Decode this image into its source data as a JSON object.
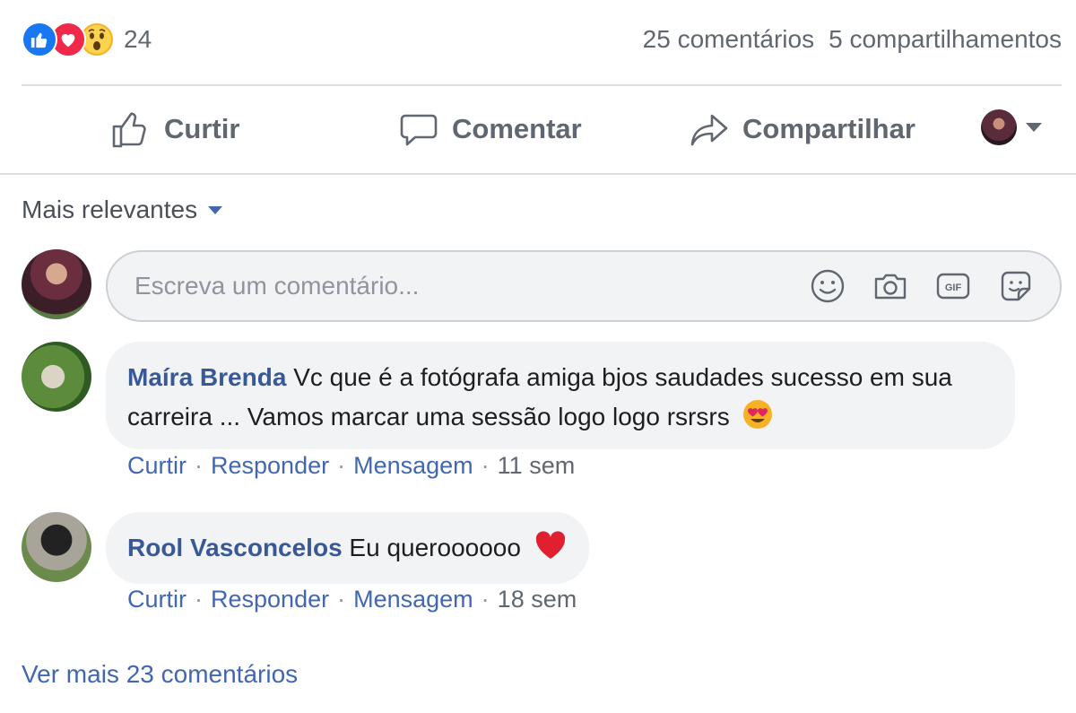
{
  "stats": {
    "reaction_icons": [
      "like-icon",
      "love-icon",
      "wow-icon"
    ],
    "reaction_count": "24",
    "comments_count": "25 comentários",
    "shares_count": "5 compartilhamentos"
  },
  "actions": {
    "like_label": "Curtir",
    "comment_label": "Comentar",
    "share_label": "Compartilhar"
  },
  "sort": {
    "label": "Mais relevantes"
  },
  "composer": {
    "placeholder": "Escreva um comentário..."
  },
  "comments": [
    {
      "author": "Maíra Brenda",
      "text": "Vc que é a fotógrafa amiga bjos saudades sucesso em sua carreira ... Vamos marcar uma sessão logo logo rsrsrs",
      "emoji": "heart-eyes-emoji",
      "actions": {
        "like": "Curtir",
        "reply": "Responder",
        "message": "Mensagem"
      },
      "time": "11 sem"
    },
    {
      "author": "Rool Vasconcelos",
      "text": "Eu queroooooo",
      "emoji": "red-heart-emoji",
      "actions": {
        "like": "Curtir",
        "reply": "Responder",
        "message": "Mensagem"
      },
      "time": "18 sem"
    }
  ],
  "more_comments": "Ver mais 23 comentários",
  "colors": {
    "link": "#385898",
    "like": "#1877f2",
    "love": "#f0284a",
    "wow": "#f7b125",
    "muted": "#606770"
  }
}
